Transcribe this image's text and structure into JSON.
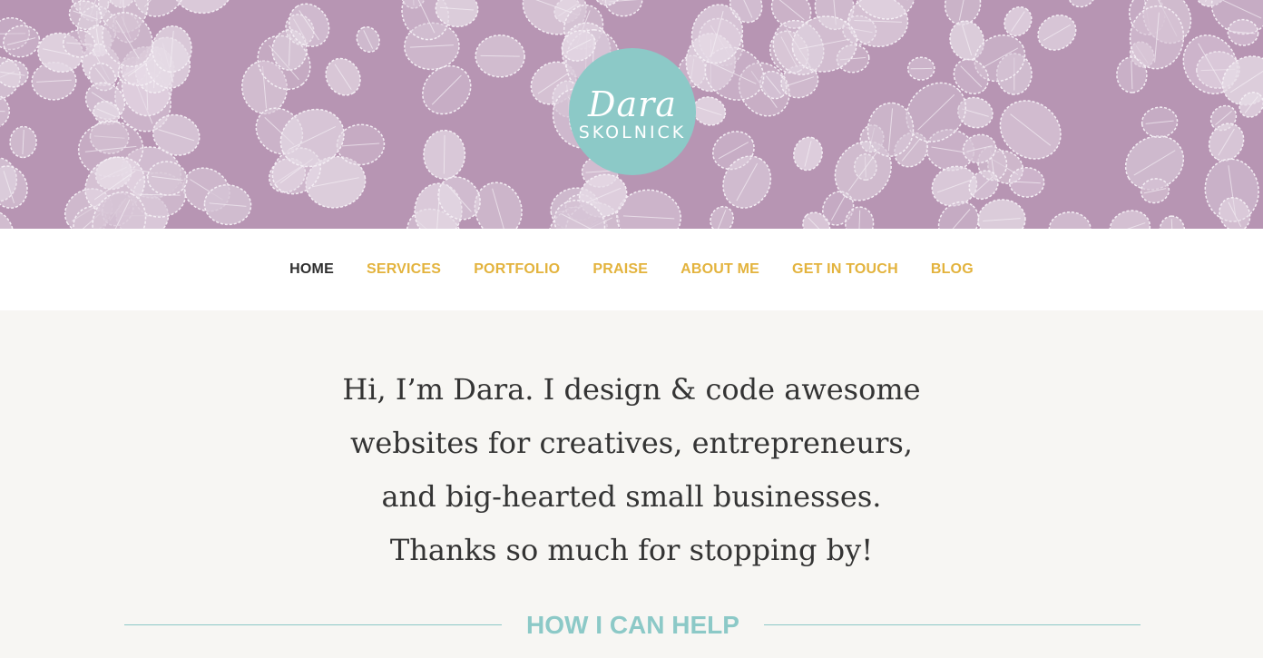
{
  "logo": {
    "script": "Dara",
    "caps": "SKOLNICK"
  },
  "nav": [
    {
      "label": "HOME",
      "active": true
    },
    {
      "label": "SERVICES"
    },
    {
      "label": "PORTFOLIO"
    },
    {
      "label": "PRAISE"
    },
    {
      "label": "ABOUT ME"
    },
    {
      "label": "GET IN TOUCH"
    },
    {
      "label": "BLOG"
    }
  ],
  "intro": "Hi, I’m Dara. I design & code awesome websites for creatives, entrepreneurs, and big-hearted small businesses. Thanks so much for stopping by!",
  "section_title": "HOW I CAN HELP",
  "colors": {
    "hero_purple": "#b795b3",
    "logo_teal": "#8cc9c7",
    "nav_gold": "#e3b33d",
    "nav_active": "#2f2f2f",
    "text": "#343434"
  }
}
